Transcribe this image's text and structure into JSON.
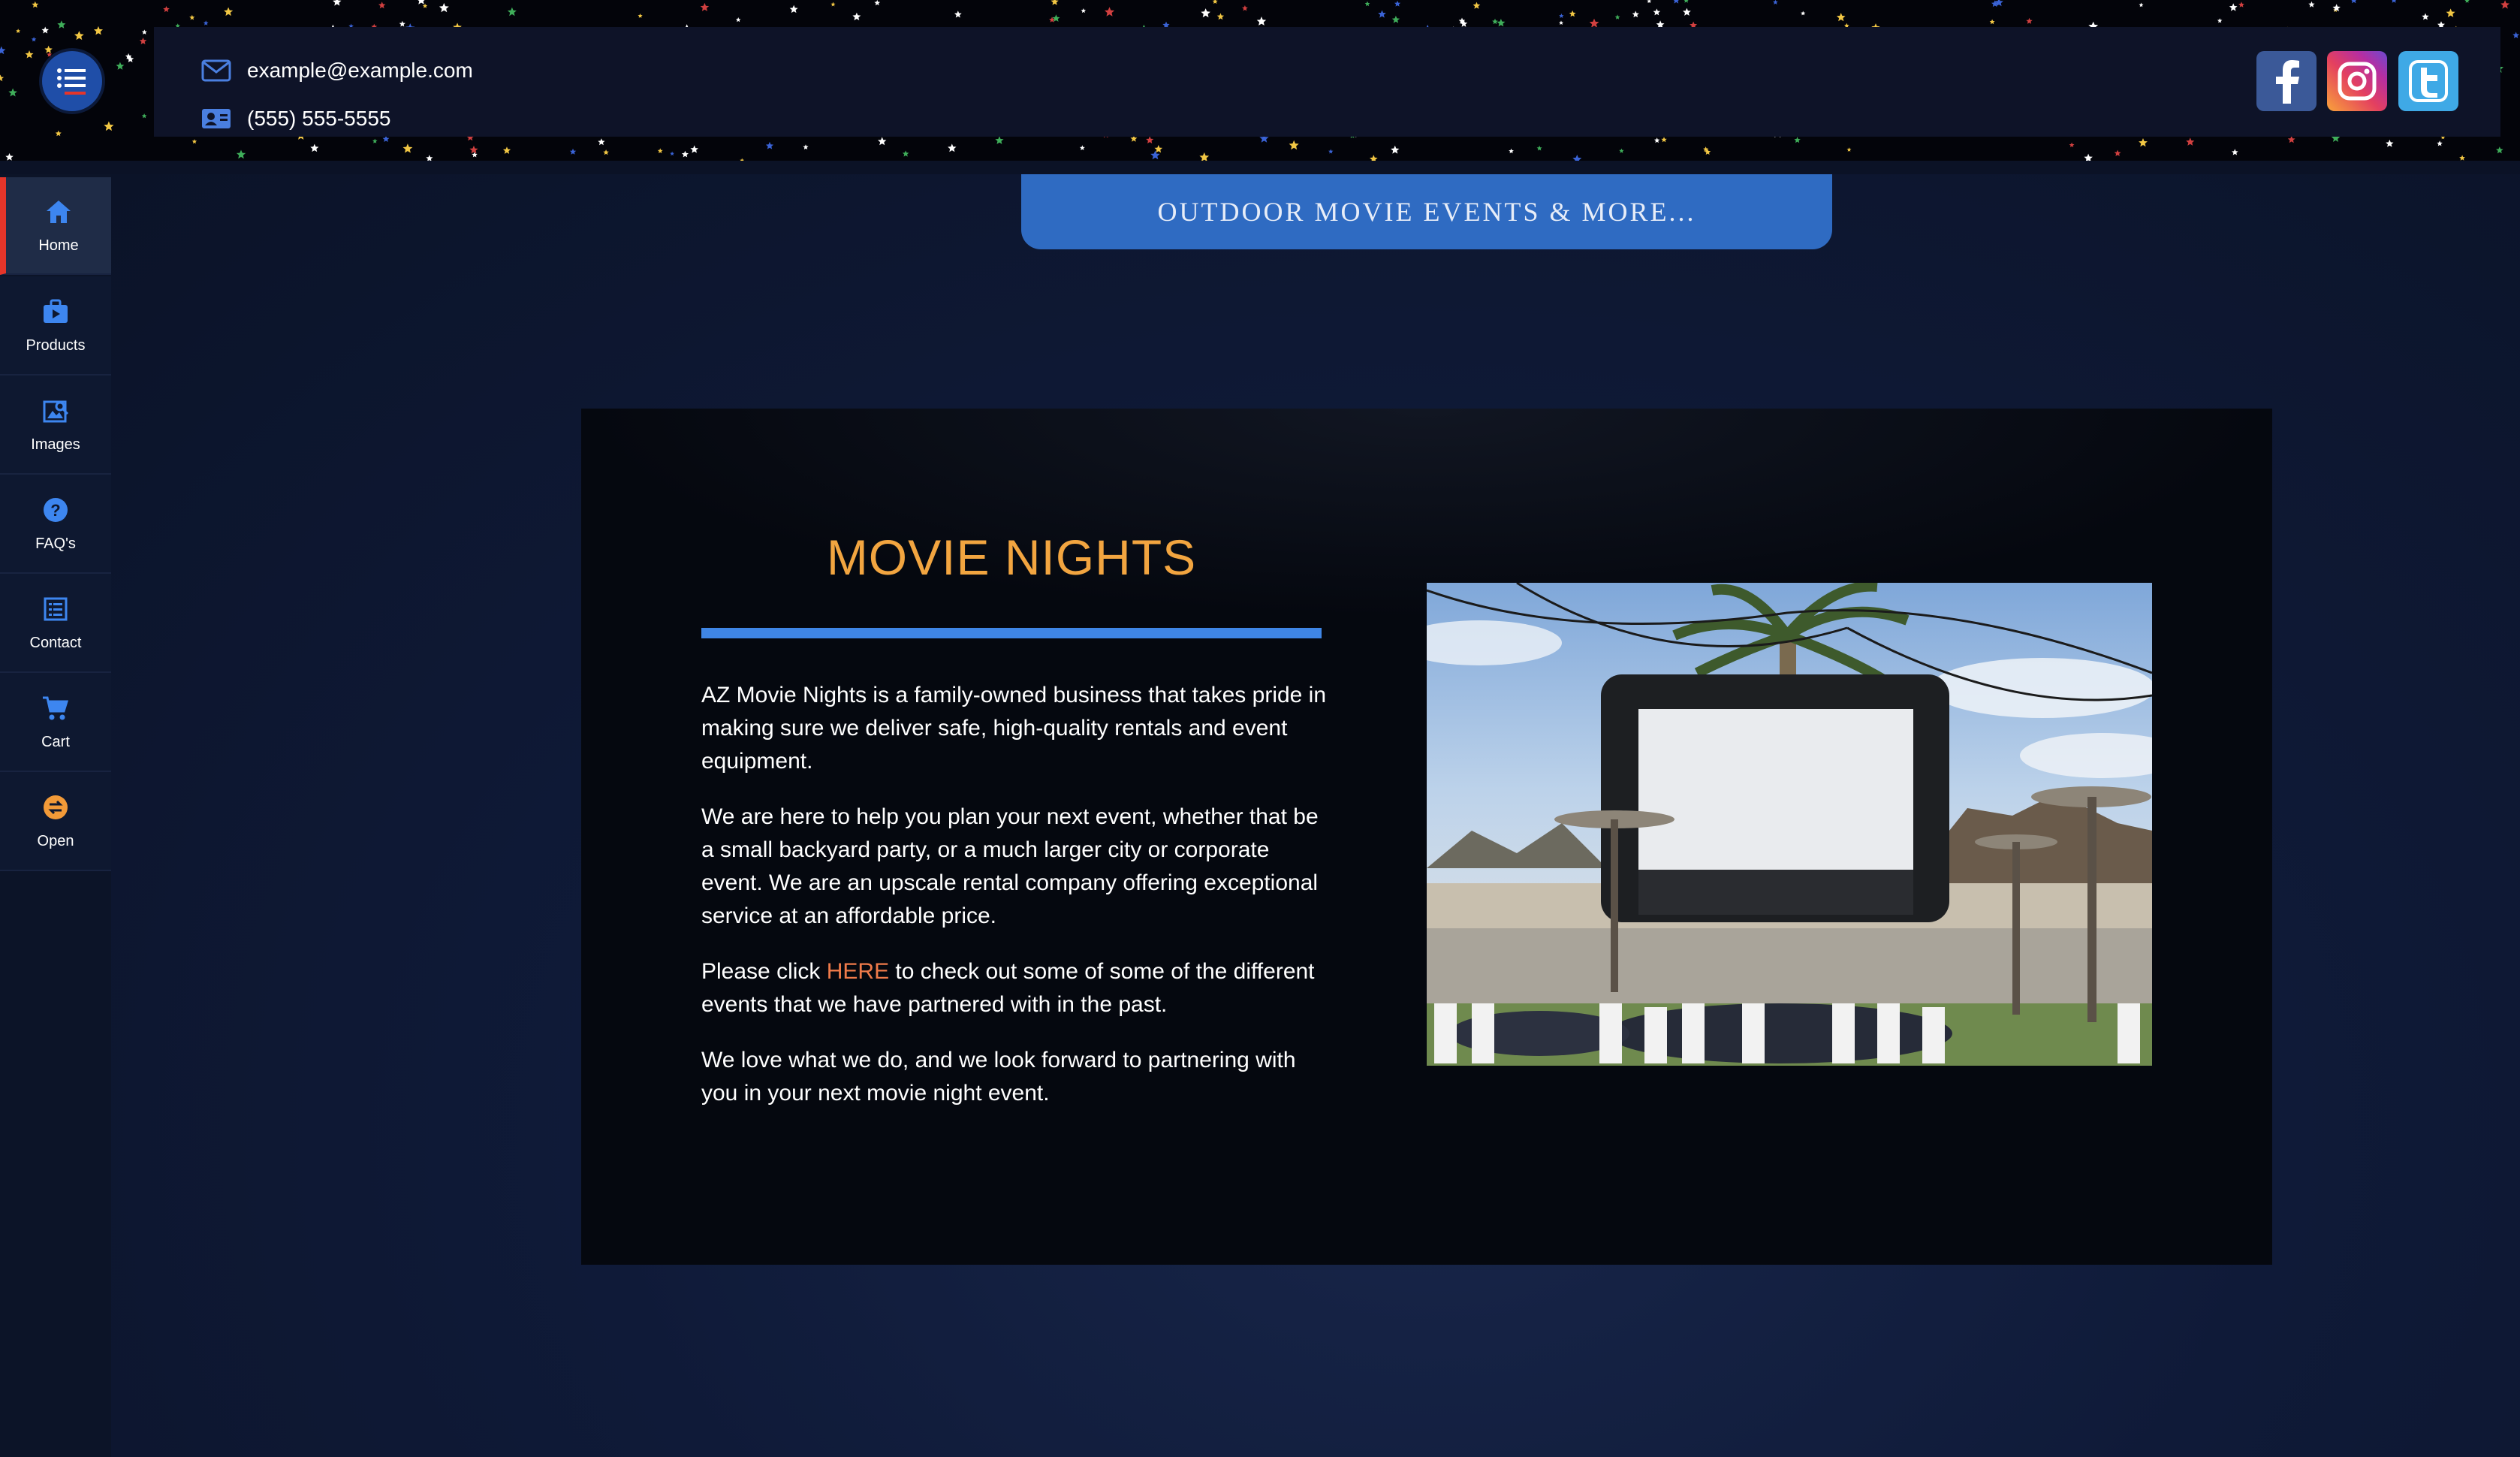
{
  "header": {
    "email": "example@example.com",
    "phone": "(555) 555-5555",
    "social": [
      "facebook",
      "instagram",
      "twitter"
    ],
    "accent_color": "#e5352a"
  },
  "sidebar": {
    "items": [
      {
        "label": "Home",
        "icon": "home-icon",
        "active": true
      },
      {
        "label": "Products",
        "icon": "products-icon"
      },
      {
        "label": "Images",
        "icon": "images-icon"
      },
      {
        "label": "FAQ's",
        "icon": "help-icon"
      },
      {
        "label": "Contact",
        "icon": "contact-icon"
      },
      {
        "label": "Cart",
        "icon": "cart-icon"
      },
      {
        "label": "Open",
        "icon": "open-icon"
      }
    ]
  },
  "main": {
    "banner": "OUTDOOR MOVIE EVENTS & MORE...",
    "title": "MOVIE NIGHTS",
    "title_color": "#f2a540",
    "rule_color": "#3f86e6",
    "paragraphs": {
      "p1": "AZ Movie Nights is a family-owned business that takes pride in making sure we deliver safe, high-quality rentals and event equipment.",
      "p2": "We are here to help you plan your next event, whether that be a small backyard party, or a much larger city or corporate event. We are an upscale rental company offering exceptional service at an affordable price.",
      "p3_before": "Please click ",
      "p3_link": "HERE",
      "p3_after": " to check out some of some of the different events that we have partnered with in the past.",
      "p4": "We love what we do, and we look forward to partnering with you in your next movie night event."
    },
    "photo_icon": "outdoor-movie-screen-photo"
  }
}
